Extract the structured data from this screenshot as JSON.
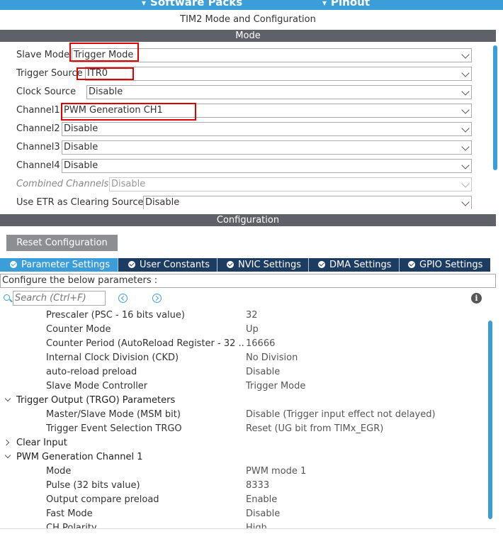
{
  "top_bar": {
    "left_label": "Software Packs",
    "right_label": "Pinout"
  },
  "window_title": "TIM2 Mode and Configuration",
  "mode_section": {
    "header": "Mode",
    "rows": [
      {
        "label": "Slave Mode",
        "value": "Trigger Mode"
      },
      {
        "label": "Trigger Source",
        "value": "ITR0"
      },
      {
        "label": "Clock Source",
        "value": "Disable"
      },
      {
        "label": "Channel1",
        "value": "PWM Generation CH1"
      },
      {
        "label": "Channel2",
        "value": "Disable"
      },
      {
        "label": "Channel3",
        "value": "Disable"
      },
      {
        "label": "Channel4",
        "value": "Disable"
      },
      {
        "label": "Combined Channels",
        "value": "Disable"
      },
      {
        "label": "Use ETR as Clearing Source",
        "value": "Disable"
      }
    ]
  },
  "config_section": {
    "header": "Configuration",
    "reset_button": "Reset Configuration",
    "tabs": [
      {
        "label": "Parameter Settings",
        "active": true
      },
      {
        "label": "User Constants",
        "active": false
      },
      {
        "label": "NVIC Settings",
        "active": false
      },
      {
        "label": "DMA Settings",
        "active": false
      },
      {
        "label": "GPIO Settings",
        "active": false
      }
    ],
    "instructions": "Configure the below parameters :",
    "search_placeholder": "Search (Ctrl+F)",
    "params": [
      {
        "name": "Prescaler (PSC - 16 bits value)",
        "value": "32"
      },
      {
        "name": "Counter Mode",
        "value": "Up"
      },
      {
        "name": "Counter Period (AutoReload Register - 32 ...",
        "value": "16666"
      },
      {
        "name": "Internal Clock Division (CKD)",
        "value": "No Division"
      },
      {
        "name": "auto-reload preload",
        "value": "Disable"
      },
      {
        "name": "Slave Mode Controller",
        "value": "Trigger Mode"
      },
      {
        "name": "Trigger Output (TRGO) Parameters",
        "value": "",
        "group": "open"
      },
      {
        "name": "Master/Slave Mode (MSM bit)",
        "value": "Disable (Trigger input effect not delayed)"
      },
      {
        "name": "Trigger Event Selection TRGO",
        "value": "Reset (UG bit from TIMx_EGR)"
      },
      {
        "name": "Clear Input",
        "value": "",
        "group": "closed"
      },
      {
        "name": "PWM Generation Channel 1",
        "value": "",
        "group": "open"
      },
      {
        "name": "Mode",
        "value": "PWM mode 1"
      },
      {
        "name": "Pulse (32 bits value)",
        "value": "8333"
      },
      {
        "name": "Output compare preload",
        "value": "Enable"
      },
      {
        "name": "Fast Mode",
        "value": "Disable"
      },
      {
        "name": "CH Polarity",
        "value": "High"
      }
    ]
  },
  "colors": {
    "accent_blue": "#3c9ed8",
    "tab_bar_navy": "#1c3c61",
    "section_header_gray": "#5f6168",
    "highlight_red": "#e00000"
  }
}
